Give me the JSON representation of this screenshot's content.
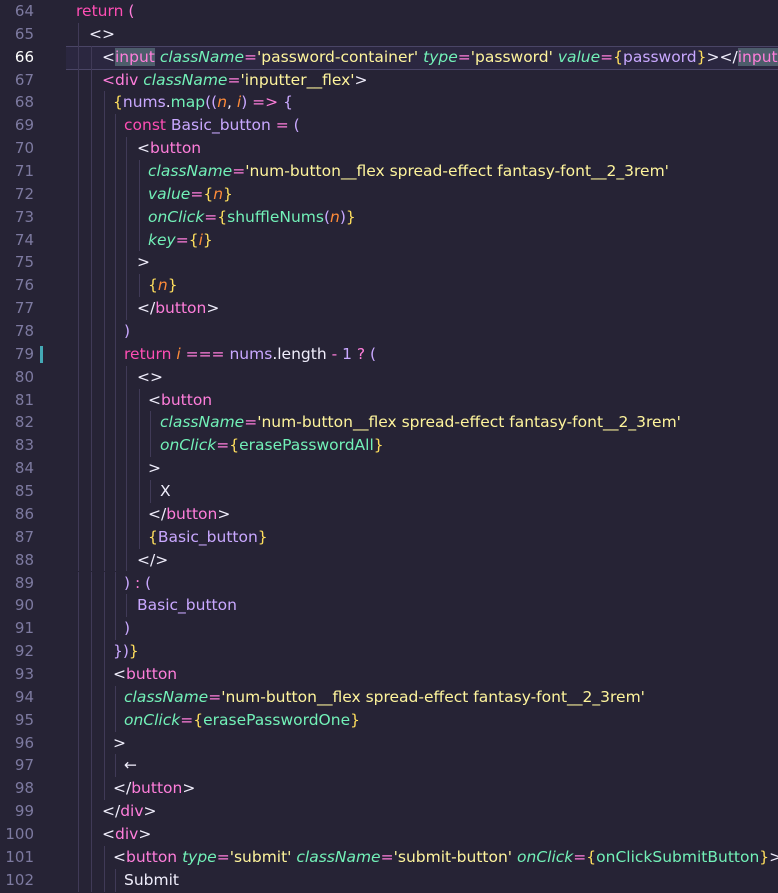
{
  "editor": {
    "lines": [
      {
        "n": "64",
        "segs": [
          [
            "return",
            "kw"
          ],
          [
            " (",
            "t"
          ]
        ],
        "indent": 76
      },
      {
        "n": "65",
        "segs": [
          [
            "<>",
            "wh"
          ]
        ],
        "indent": 89
      },
      {
        "n": "66",
        "segs": [
          [
            "<",
            "wh"
          ],
          [
            "input",
            "tsel"
          ],
          [
            " ",
            ""
          ],
          [
            "className",
            "attr"
          ],
          [
            "=",
            "t"
          ],
          [
            "'password-container'",
            "str"
          ],
          [
            " ",
            ""
          ],
          [
            "type",
            "attr"
          ],
          [
            "=",
            "t"
          ],
          [
            "'password'",
            "str"
          ],
          [
            " ",
            ""
          ],
          [
            "value",
            "attr"
          ],
          [
            "=",
            "t"
          ],
          [
            "{",
            "br"
          ],
          [
            "password",
            "pu"
          ],
          [
            "}",
            "br"
          ],
          [
            ">",
            "wh"
          ],
          [
            "</",
            "wh"
          ],
          [
            "input",
            "tsel"
          ],
          [
            ">",
            "wh"
          ]
        ],
        "indent": 102
      },
      {
        "n": "67",
        "segs": [
          [
            "<div",
            "t"
          ],
          [
            " ",
            ""
          ],
          [
            "className",
            "attr"
          ],
          [
            "=",
            "t"
          ],
          [
            "'inputter__flex'",
            "str"
          ],
          [
            ">",
            "wh"
          ]
        ],
        "indent": 102
      },
      {
        "n": "68",
        "segs": [
          [
            "{",
            "br"
          ],
          [
            "nums",
            "pu"
          ],
          [
            ".",
            "wh"
          ],
          [
            "map",
            "fn"
          ],
          [
            "((",
            "pu"
          ],
          [
            "n",
            "p"
          ],
          [
            ", ",
            "wh"
          ],
          [
            "i",
            "p"
          ],
          [
            ") ",
            "pu"
          ],
          [
            "=>",
            "t"
          ],
          [
            " {",
            "pu"
          ]
        ],
        "indent": 113
      },
      {
        "n": "69",
        "segs": [
          [
            "const",
            "kw"
          ],
          [
            " Basic_button ",
            "pu"
          ],
          [
            "=",
            "t"
          ],
          [
            " (",
            "pu"
          ]
        ],
        "indent": 124
      },
      {
        "n": "70",
        "segs": [
          [
            "<",
            "wh"
          ],
          [
            "button",
            "t"
          ]
        ],
        "indent": 137
      },
      {
        "n": "71",
        "segs": [
          [
            "className",
            "attr"
          ],
          [
            "=",
            "t"
          ],
          [
            "'num-button__flex spread-effect fantasy-font__2_3rem'",
            "str"
          ]
        ],
        "indent": 148
      },
      {
        "n": "72",
        "segs": [
          [
            "value",
            "attr"
          ],
          [
            "=",
            "t"
          ],
          [
            "{",
            "br"
          ],
          [
            "n",
            "p"
          ],
          [
            "}",
            "br"
          ]
        ],
        "indent": 148
      },
      {
        "n": "73",
        "segs": [
          [
            "onClick",
            "attr"
          ],
          [
            "=",
            "t"
          ],
          [
            "{",
            "br"
          ],
          [
            "shuffleNums",
            "fn"
          ],
          [
            "(",
            "pu"
          ],
          [
            "n",
            "p"
          ],
          [
            ")",
            "pu"
          ],
          [
            "}",
            "br"
          ]
        ],
        "indent": 148
      },
      {
        "n": "74",
        "segs": [
          [
            "key",
            "attr"
          ],
          [
            "=",
            "t"
          ],
          [
            "{",
            "br"
          ],
          [
            "i",
            "p"
          ],
          [
            "}",
            "br"
          ]
        ],
        "indent": 148
      },
      {
        "n": "75",
        "segs": [
          [
            ">",
            "wh"
          ]
        ],
        "indent": 137
      },
      {
        "n": "76",
        "segs": [
          [
            "{",
            "br"
          ],
          [
            "n",
            "p"
          ],
          [
            "}",
            "br"
          ]
        ],
        "indent": 148
      },
      {
        "n": "77",
        "segs": [
          [
            "</",
            "wh"
          ],
          [
            "button",
            "t"
          ],
          [
            ">",
            "wh"
          ]
        ],
        "indent": 137
      },
      {
        "n": "78",
        "segs": [
          [
            ")",
            "pu"
          ]
        ],
        "indent": 124
      },
      {
        "n": "79",
        "segs": [
          [
            "return",
            "kw"
          ],
          [
            " ",
            ""
          ],
          [
            "i",
            "p"
          ],
          [
            " === ",
            "t"
          ],
          [
            "nums",
            "pu"
          ],
          [
            ".length ",
            "wh"
          ],
          [
            "-",
            "t"
          ],
          [
            " 1 ",
            "pu"
          ],
          [
            "?",
            "t"
          ],
          [
            " (",
            "pu"
          ]
        ],
        "indent": 124
      },
      {
        "n": "80",
        "segs": [
          [
            "<>",
            "wh"
          ]
        ],
        "indent": 137
      },
      {
        "n": "81",
        "segs": [
          [
            "<",
            "wh"
          ],
          [
            "button",
            "t"
          ]
        ],
        "indent": 148
      },
      {
        "n": "82",
        "segs": [
          [
            "className",
            "attr"
          ],
          [
            "=",
            "t"
          ],
          [
            "'num-button__flex spread-effect fantasy-font__2_3rem'",
            "str"
          ]
        ],
        "indent": 160
      },
      {
        "n": "83",
        "segs": [
          [
            "onClick",
            "attr"
          ],
          [
            "=",
            "t"
          ],
          [
            "{",
            "br"
          ],
          [
            "erasePasswordAll",
            "fn"
          ],
          [
            "}",
            "br"
          ]
        ],
        "indent": 160
      },
      {
        "n": "84",
        "segs": [
          [
            ">",
            "wh"
          ]
        ],
        "indent": 148
      },
      {
        "n": "85",
        "segs": [
          [
            "X",
            "wh"
          ]
        ],
        "indent": 160
      },
      {
        "n": "86",
        "segs": [
          [
            "</",
            "wh"
          ],
          [
            "button",
            "t"
          ],
          [
            ">",
            "wh"
          ]
        ],
        "indent": 148
      },
      {
        "n": "87",
        "segs": [
          [
            "{",
            "br"
          ],
          [
            "Basic_button",
            "pu"
          ],
          [
            "}",
            "br"
          ]
        ],
        "indent": 148
      },
      {
        "n": "88",
        "segs": [
          [
            "</>",
            "wh"
          ]
        ],
        "indent": 137
      },
      {
        "n": "89",
        "segs": [
          [
            ")",
            "pu"
          ],
          [
            " : ",
            "t"
          ],
          [
            "(",
            "pu"
          ]
        ],
        "indent": 124
      },
      {
        "n": "90",
        "segs": [
          [
            "Basic_button",
            "pu"
          ]
        ],
        "indent": 137
      },
      {
        "n": "91",
        "segs": [
          [
            ")",
            "pu"
          ]
        ],
        "indent": 124
      },
      {
        "n": "92",
        "segs": [
          [
            "})",
            "pu"
          ],
          [
            "}",
            "br"
          ]
        ],
        "indent": 113
      },
      {
        "n": "93",
        "segs": [
          [
            "<",
            "wh"
          ],
          [
            "button",
            "t"
          ]
        ],
        "indent": 113
      },
      {
        "n": "94",
        "segs": [
          [
            "className",
            "attr"
          ],
          [
            "=",
            "t"
          ],
          [
            "'num-button__flex spread-effect fantasy-font__2_3rem'",
            "str"
          ]
        ],
        "indent": 124
      },
      {
        "n": "95",
        "segs": [
          [
            "onClick",
            "attr"
          ],
          [
            "=",
            "t"
          ],
          [
            "{",
            "br"
          ],
          [
            "erasePasswordOne",
            "fn"
          ],
          [
            "}",
            "br"
          ]
        ],
        "indent": 124
      },
      {
        "n": "96",
        "segs": [
          [
            ">",
            "wh"
          ]
        ],
        "indent": 113
      },
      {
        "n": "97",
        "segs": [
          [
            "←",
            "wh"
          ]
        ],
        "indent": 124
      },
      {
        "n": "98",
        "segs": [
          [
            "</",
            "wh"
          ],
          [
            "button",
            "t"
          ],
          [
            ">",
            "wh"
          ]
        ],
        "indent": 113
      },
      {
        "n": "99",
        "segs": [
          [
            "</",
            "wh"
          ],
          [
            "div",
            "t"
          ],
          [
            ">",
            "wh"
          ]
        ],
        "indent": 102
      },
      {
        "n": "100",
        "segs": [
          [
            "<",
            "wh"
          ],
          [
            "div",
            "t"
          ],
          [
            ">",
            "wh"
          ]
        ],
        "indent": 102
      },
      {
        "n": "101",
        "segs": [
          [
            "<",
            "wh"
          ],
          [
            "button",
            "t"
          ],
          [
            " ",
            ""
          ],
          [
            "type",
            "attr"
          ],
          [
            "=",
            "t"
          ],
          [
            "'submit'",
            "str"
          ],
          [
            " ",
            ""
          ],
          [
            "className",
            "attr"
          ],
          [
            "=",
            "t"
          ],
          [
            "'submit-button'",
            "str"
          ],
          [
            " ",
            ""
          ],
          [
            "onClick",
            "attr"
          ],
          [
            "=",
            "t"
          ],
          [
            "{",
            "br"
          ],
          [
            "onClickSubmitButton",
            "fn"
          ],
          [
            "}",
            "br"
          ],
          [
            ">",
            "wh"
          ]
        ],
        "indent": 113
      },
      {
        "n": "102",
        "segs": [
          [
            "Submit",
            "wh"
          ]
        ],
        "indent": 124
      }
    ]
  },
  "colors": {
    "background": "#262335",
    "line_number": "#7d7aa0"
  }
}
